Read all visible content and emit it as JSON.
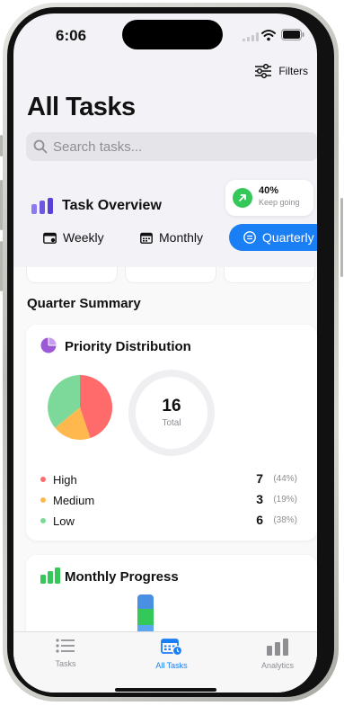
{
  "status": {
    "time": "6:06"
  },
  "header": {
    "filters_label": "Filters",
    "title": "All Tasks"
  },
  "search": {
    "placeholder": "Search tasks..."
  },
  "overview": {
    "title": "Task Overview",
    "progress_value": "40%",
    "progress_caption": "Keep going"
  },
  "periods": [
    {
      "label": "Weekly",
      "selected": false
    },
    {
      "label": "Monthly",
      "selected": false
    },
    {
      "label": "Quarterly",
      "selected": true
    }
  ],
  "summary": {
    "title": "Quarter Summary",
    "priority": {
      "title": "Priority Distribution",
      "total_value": "16",
      "total_label": "Total",
      "items": [
        {
          "name": "High",
          "count": "7",
          "pct": "(44%)",
          "color": "#ff6b6b"
        },
        {
          "name": "Medium",
          "count": "3",
          "pct": "(19%)",
          "color": "#ffb84d"
        },
        {
          "name": "Low",
          "count": "6",
          "pct": "(38%)",
          "color": "#7dd99a"
        }
      ]
    },
    "monthly": {
      "title": "Monthly Progress"
    }
  },
  "tabbar": {
    "tasks": "Tasks",
    "all_tasks": "All Tasks",
    "analytics": "Analytics"
  },
  "colors": {
    "accent": "#1a7ef5",
    "success": "#34c759",
    "purple": "#7b5ce6"
  }
}
